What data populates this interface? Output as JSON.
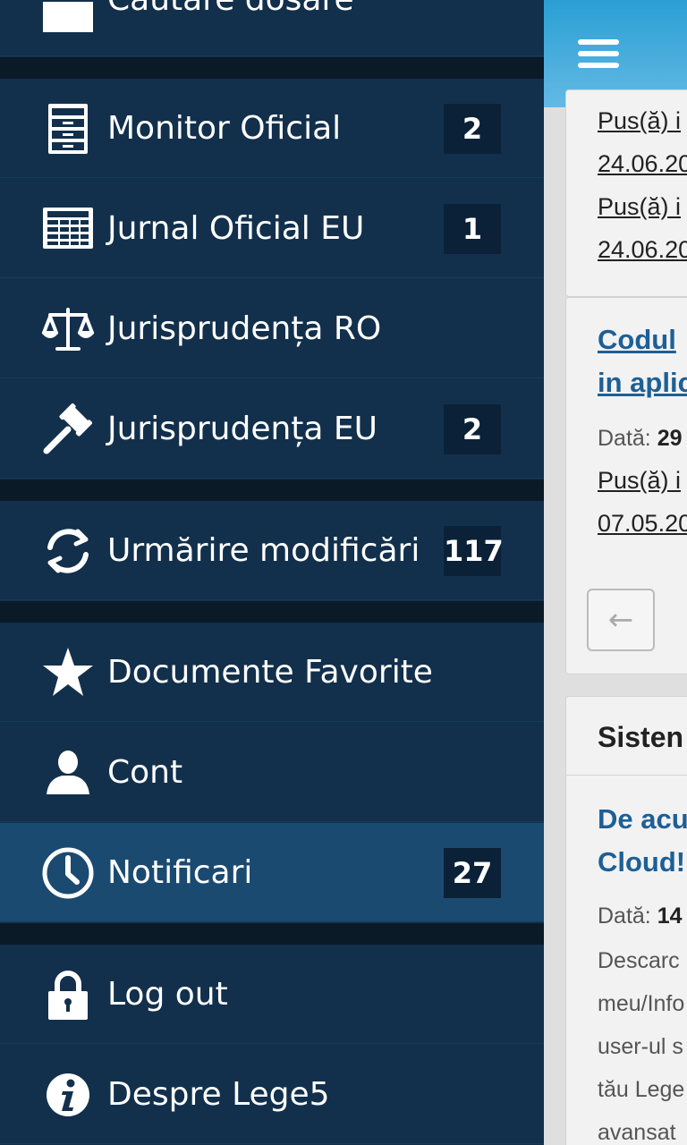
{
  "drawer": {
    "top_item": {
      "label": "Cautare dosare",
      "icon": "folder-icon"
    },
    "items": [
      {
        "label": "Monitor Oficial",
        "badge": "2",
        "icon": "cabinet-icon"
      },
      {
        "label": "Jurnal Oficial EU",
        "badge": "1",
        "icon": "newspaper-icon"
      },
      {
        "label": "Jurisprudența RO",
        "badge": "",
        "icon": "scales-icon"
      },
      {
        "label": "Jurisprudența EU",
        "badge": "2",
        "icon": "gavel-icon"
      },
      {
        "label": "Urmărire modificări",
        "badge": "117",
        "icon": "refresh-icon"
      },
      {
        "label": "Documente Favorite",
        "badge": "",
        "icon": "star-icon"
      },
      {
        "label": "Cont",
        "badge": "",
        "icon": "user-icon"
      },
      {
        "label": "Notificari",
        "badge": "27",
        "icon": "clock-icon",
        "active": true
      },
      {
        "label": "Log out",
        "badge": "",
        "icon": "lock-icon"
      },
      {
        "label": "Despre Lege5",
        "badge": "",
        "icon": "info-icon"
      }
    ]
  },
  "page": {
    "line1": "Pus(ă) i",
    "line2": "24.06.20",
    "line3": "Pus(ă) i",
    "line4": "24.06.20",
    "card_title_1": "Codul",
    "card_title_2": "in aplic",
    "date_label": "Dată:",
    "date_value_1": "29",
    "line5": "Pus(ă) i",
    "line6": "07.05.20",
    "back_arrow": "←",
    "section_header": "Sisten",
    "news_title_1": "De acu",
    "news_title_2": "Cloud!",
    "date_value_2": "14",
    "body1": "Descarc",
    "body2": "meu/Info",
    "body3": "user-ul s",
    "body4": "tău Lege",
    "body5": "avansat"
  },
  "colors": {
    "drawer_bg": "#12304c",
    "drawer_active": "#1b4a70",
    "separator": "#0b1a27",
    "badge_bg": "#0b2138",
    "topbar": "#2a9fd4",
    "link": "#1d5f96"
  }
}
